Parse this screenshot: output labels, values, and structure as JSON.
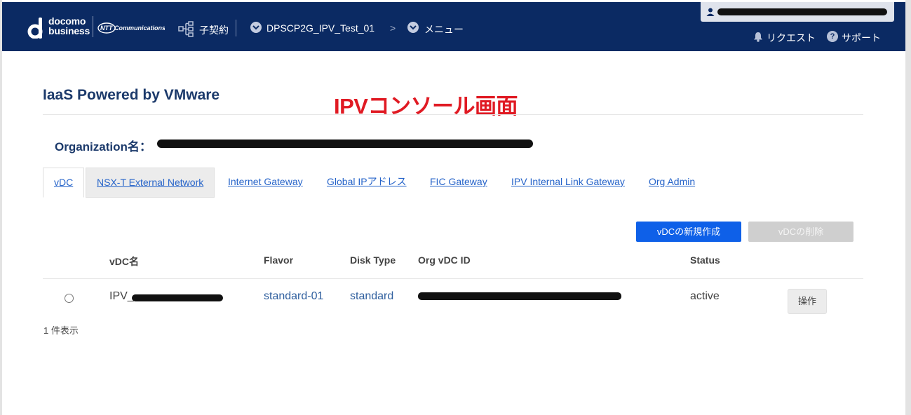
{
  "header": {
    "brand_line1": "docomo",
    "brand_line2": "business",
    "ntt_logo_text": "NTT Communications",
    "contract_label": "子契約",
    "project_label": "DPSCP2G_IPV_Test_01",
    "crumb_separator": ">",
    "menu_label": "メニュー",
    "request_label": "リクエスト",
    "support_icon_glyph": "?",
    "support_label": "サポート"
  },
  "page": {
    "title": "IaaS Powered by VMware",
    "annotation": "IPVコンソール画面",
    "org_label": "Organization名："
  },
  "tabs": [
    {
      "label": "vDC",
      "active": true
    },
    {
      "label": "NSX-T External Network"
    },
    {
      "label": "Internet Gateway"
    },
    {
      "label": "Global IPアドレス"
    },
    {
      "label": "FIC Gateway"
    },
    {
      "label": "IPV Internal Link Gateway"
    },
    {
      "label": "Org Admin"
    }
  ],
  "actions": {
    "create_label": "vDCの新規作成",
    "delete_label": "vDCの削除"
  },
  "table": {
    "headers": {
      "name": "vDC名",
      "flavor": "Flavor",
      "disk_type": "Disk Type",
      "org_vdc_id": "Org vDC ID",
      "status": "Status"
    },
    "rows": [
      {
        "name_prefix": "IPV_",
        "flavor": "standard-01",
        "disk_type": "standard",
        "status": "active",
        "operation_label": "操作"
      }
    ],
    "count_text": "1 件表示"
  },
  "colors": {
    "header_bg": "#0b2a63",
    "primary_button": "#0e60e8",
    "annotation_red": "#e01a23",
    "title_navy": "#1c3a6b"
  }
}
